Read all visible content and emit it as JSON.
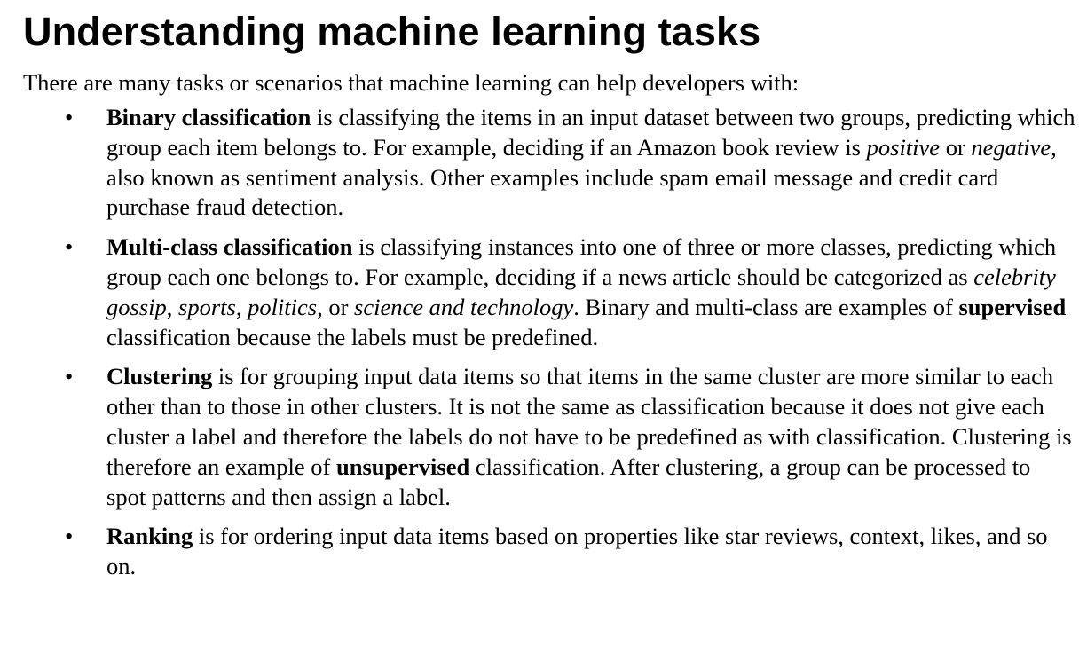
{
  "heading": "Understanding machine learning tasks",
  "intro": "There are many tasks or scenarios that machine learning can help developers with:",
  "bullet_symbol": "•",
  "items": [
    {
      "term": "Binary classification",
      "t1": " is classifying the items in an input dataset between two groups, predicting which group each item belongs to. For example, deciding if an Amazon book review is ",
      "em1": "positive",
      "t2": " or ",
      "em2": "negative",
      "t3": ", also known as sentiment analysis. Other examples include spam email message and credit card purchase fraud detection."
    },
    {
      "term": "Multi-class classification",
      "t1": " is classifying instances into one of three or more classes, predicting which group each one belongs to. For example, deciding if a news article should be categorized as ",
      "em1": "celebrity gossip",
      "t2": ", ",
      "em2": "sports",
      "t3": ", ",
      "em3": "politics",
      "t4": ", or ",
      "em4": "science and technology",
      "t5": ". Binary and multi-class are examples of ",
      "strong1": "supervised",
      "t6": " classification because the labels must be predefined."
    },
    {
      "term": "Clustering",
      "t1": " is for grouping input data items so that items in the same cluster are more similar to each other than to those in other clusters. It is not the same as classification because it does not give each cluster a label and therefore the labels do not have to be predefined as with classification. Clustering is therefore an example of ",
      "strong1": "unsupervised",
      "t2": " classification. After clustering, a group can be processed to spot patterns and then assign a label."
    },
    {
      "term": "Ranking",
      "t1": " is for ordering input data items based on properties like star reviews, context, likes, and so on."
    }
  ]
}
